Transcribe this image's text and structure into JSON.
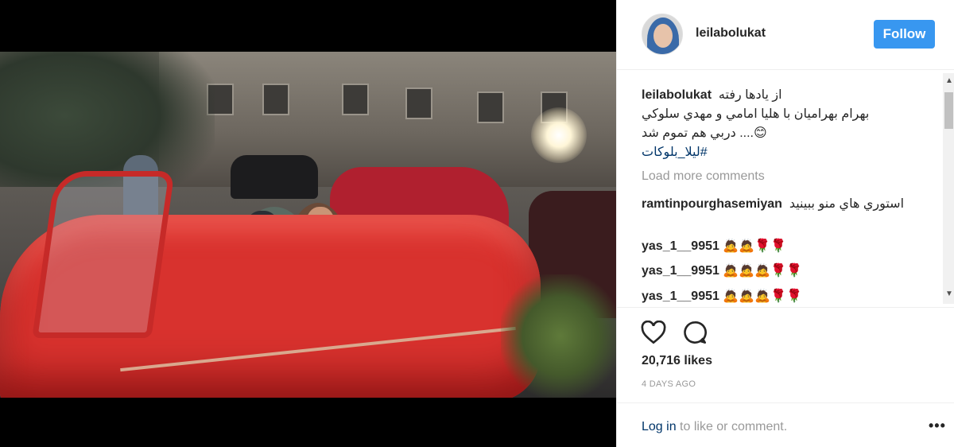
{
  "post": {
    "username": "leilabolukat",
    "follow_label": "Follow",
    "caption_user": "leilabolukat",
    "caption_lines": [
      "از يادها رفته",
      "بهرام بهراميان با هليا امامي و مهدي سلوكي",
      "😊.... دربي هم تموم شد"
    ],
    "hashtag": "#ليلا_بلوكات",
    "load_more": "Load more comments",
    "comments": [
      {
        "user": "ramtinpourghasemiyan",
        "text": "استوري هاي منو ببينيد"
      },
      {
        "user": "yas_1__9951",
        "text": "🙇🙇🌹🌹"
      },
      {
        "user": "yas_1__9951",
        "text": "🙇🙇🙇🌹🌹"
      },
      {
        "user": "yas_1__9951",
        "text": "🙇🙇🙇🌹🌹"
      }
    ],
    "likes": "20,716 likes",
    "time_ago": "4 DAYS AGO",
    "login_link": "Log in",
    "login_rest": " to like or comment.",
    "more_icon": "•••"
  },
  "icons": [
    "heart-icon",
    "comment-icon",
    "more-options-icon"
  ],
  "colors": {
    "follow_button": "#3897f0",
    "link": "#003569",
    "muted": "#999999"
  }
}
